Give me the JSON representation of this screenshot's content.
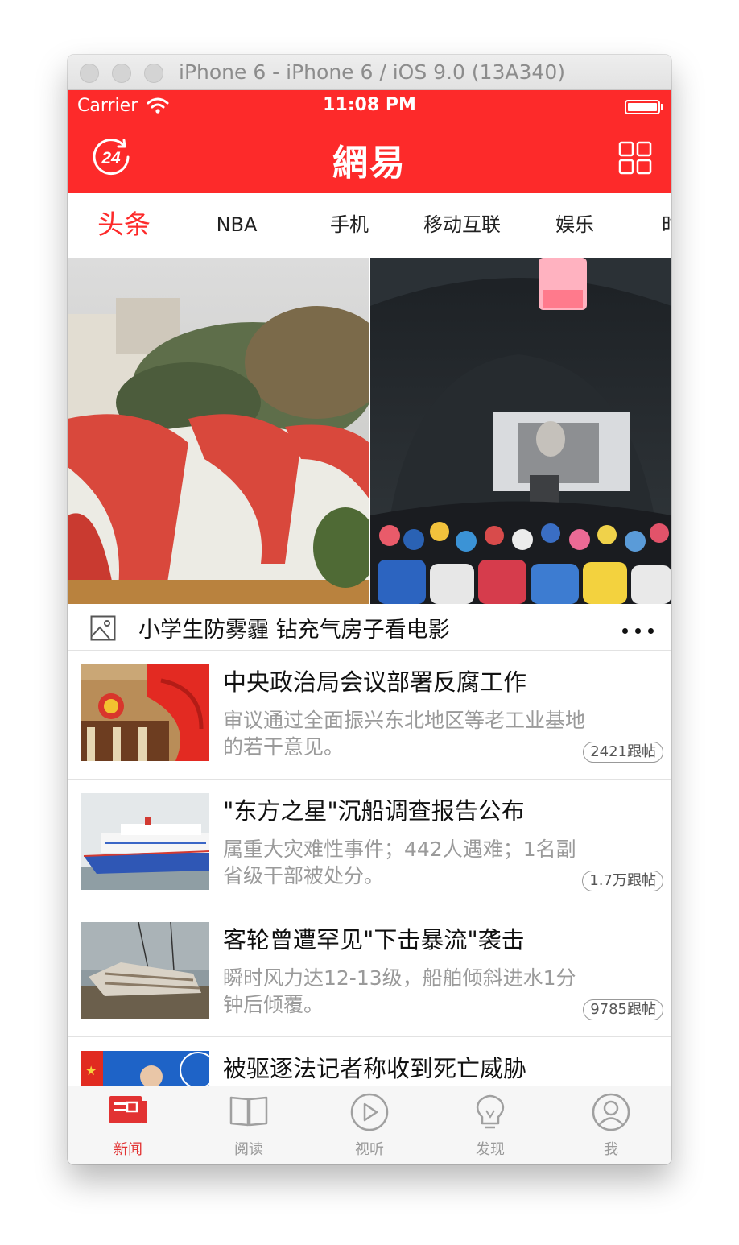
{
  "window": {
    "title": "iPhone 6 - iPhone 6 / iOS 9.0 (13A340)"
  },
  "status_bar": {
    "carrier": "Carrier",
    "time": "11:08 PM"
  },
  "nav_bar": {
    "left_button": "24",
    "logo": "網易",
    "brand_color": "#fd2a2a"
  },
  "channel_tabs": [
    {
      "label": "头条",
      "active": true
    },
    {
      "label": "NBA",
      "active": false
    },
    {
      "label": "手机",
      "active": false
    },
    {
      "label": "移动互联",
      "active": false
    },
    {
      "label": "娱乐",
      "active": false
    },
    {
      "label": "时",
      "active": false
    }
  ],
  "hero": {
    "caption": "小学生防雾霾 钻充气房子看电影"
  },
  "news": [
    {
      "title": "中央政治局会议部署反腐工作",
      "digest": "审议通过全面振兴东北地区等老工业基地的若干意见。",
      "replies": "2421跟帖"
    },
    {
      "title": "\"东方之星\"沉船调查报告公布",
      "digest": "属重大灾难性事件；442人遇难；1名副省级干部被处分。",
      "replies": "1.7万跟帖"
    },
    {
      "title": "客轮曾遭罕见\"下击暴流\"袭击",
      "digest": "瞬时风力达12-13级，船舶倾斜进水1分钟后倾覆。",
      "replies": "9785跟帖"
    },
    {
      "title": "被驱逐法记者称收到死亡威胁",
      "digest": "",
      "replies": ""
    }
  ],
  "tab_bar": [
    {
      "label": "新闻",
      "icon": "news-icon",
      "active": true
    },
    {
      "label": "阅读",
      "icon": "book-icon",
      "active": false
    },
    {
      "label": "视听",
      "icon": "play-icon",
      "active": false
    },
    {
      "label": "发现",
      "icon": "bulb-icon",
      "active": false
    },
    {
      "label": "我",
      "icon": "user-icon",
      "active": false
    }
  ]
}
